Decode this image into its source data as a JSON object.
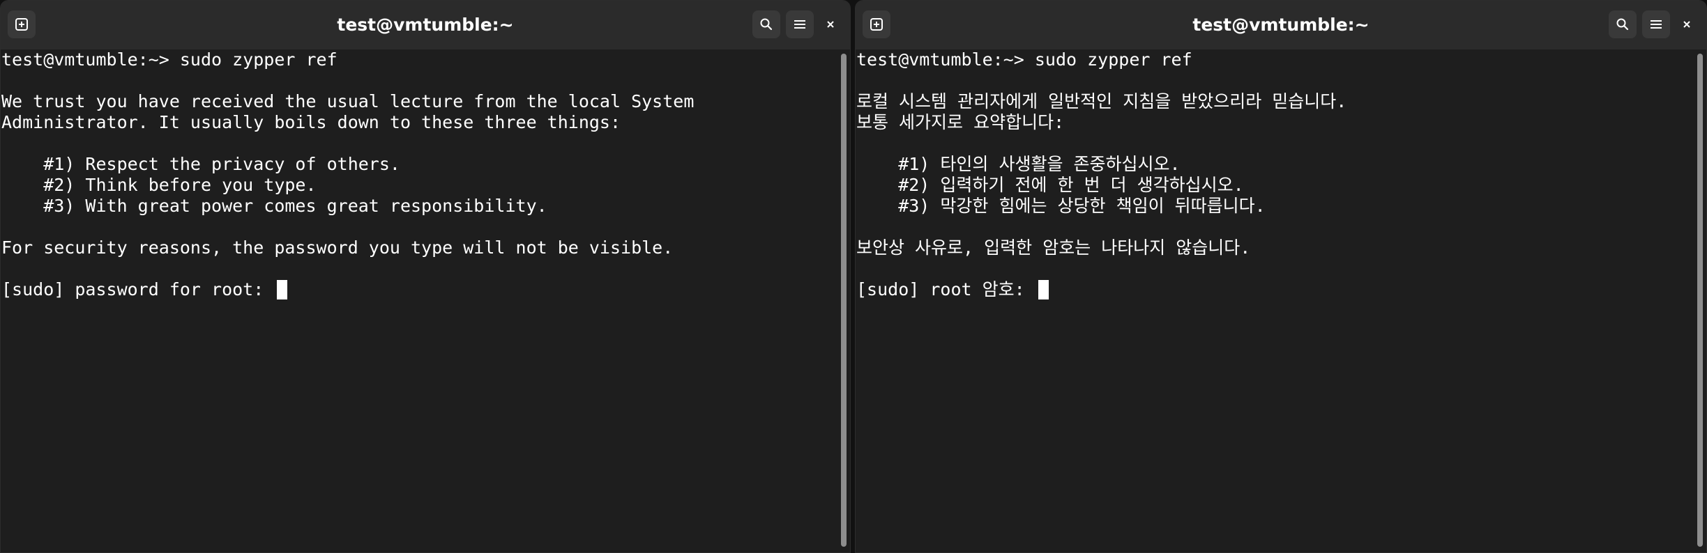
{
  "theme": {
    "window_bg": "#1e1e1e",
    "headerbar_bg": "#2b2b2b",
    "button_bg": "#393939",
    "text_color": "#ffffff",
    "scrollbar_color": "#8e8e8e"
  },
  "windows": [
    {
      "title": "test@vmtumble:~",
      "icons": {
        "new_tab": "new-tab-icon",
        "search": "search-icon",
        "menu": "hamburger-menu-icon",
        "close": "close-icon"
      },
      "lines": [
        "test@vmtumble:~> sudo zypper ref",
        "",
        "We trust you have received the usual lecture from the local System",
        "Administrator. It usually boils down to these three things:",
        "",
        "    #1) Respect the privacy of others.",
        "    #2) Think before you type.",
        "    #3) With great power comes great responsibility.",
        "",
        "For security reasons, the password you type will not be visible.",
        ""
      ],
      "prompt_line": "[sudo] password for root: "
    },
    {
      "title": "test@vmtumble:~",
      "icons": {
        "new_tab": "new-tab-icon",
        "search": "search-icon",
        "menu": "hamburger-menu-icon",
        "close": "close-icon"
      },
      "lines": [
        "test@vmtumble:~> sudo zypper ref",
        "",
        "로컬 시스템 관리자에게 일반적인 지침을 받았으리라 믿습니다.",
        "보통 세가지로 요약합니다:",
        "",
        "    #1) 타인의 사생활을 존중하십시오.",
        "    #2) 입력하기 전에 한 번 더 생각하십시오.",
        "    #3) 막강한 힘에는 상당한 책임이 뒤따릅니다.",
        "",
        "보안상 사유로, 입력한 암호는 나타나지 않습니다.",
        ""
      ],
      "prompt_line": "[sudo] root 암호: "
    }
  ]
}
